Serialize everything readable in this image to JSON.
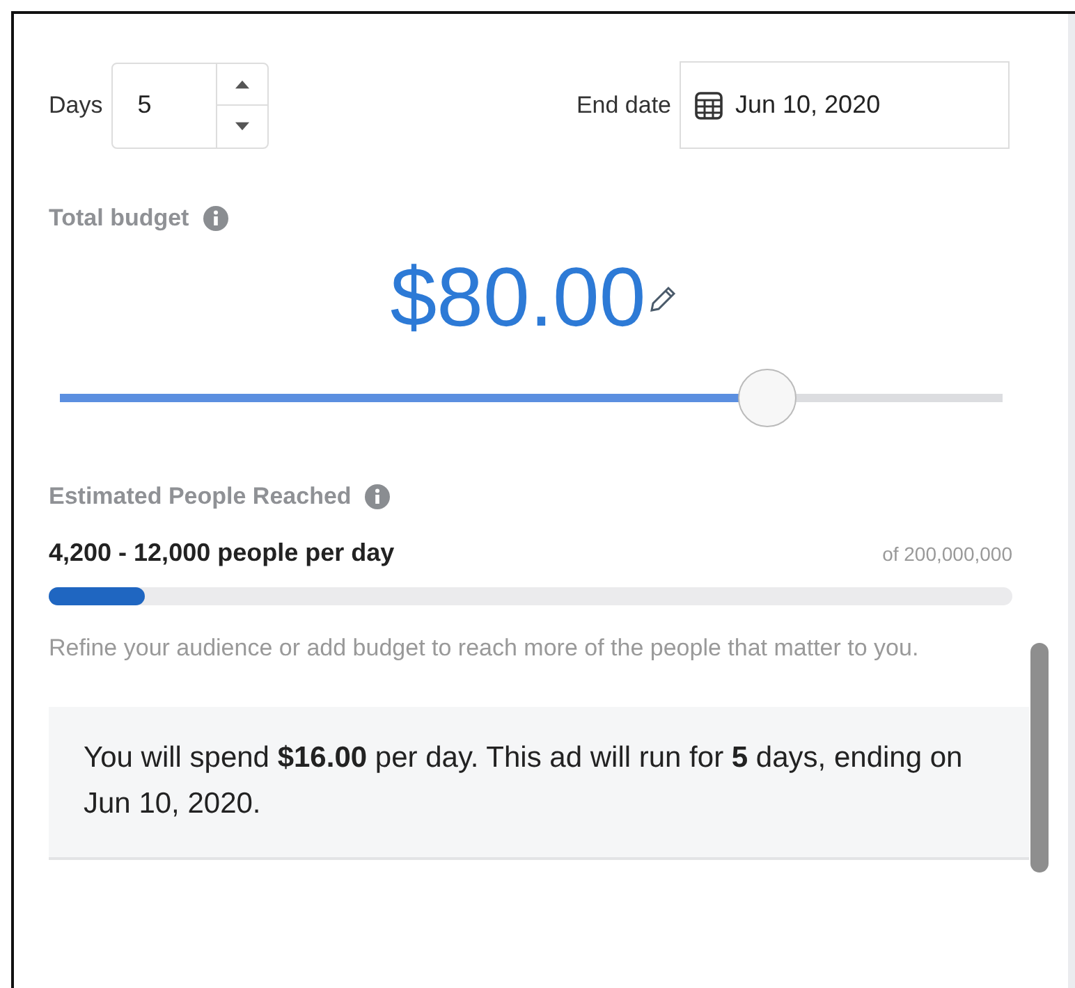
{
  "duration": {
    "days_label": "Days",
    "days_value": "5",
    "end_date_label": "End date",
    "end_date_value": "Jun 10, 2020"
  },
  "budget": {
    "label": "Total budget",
    "amount": "$80.00",
    "level": 0.75
  },
  "reach": {
    "label": "Estimated People Reached",
    "range": "4,200 - 12,000 people per day",
    "total": "of 200,000,000",
    "level": 0.1,
    "hint": "Refine your audience or add budget to reach more of the people that matter to you."
  },
  "summary": "You will spend **$16.00** per day. This ad will run for **5** days, ending on Jun 10, 2020."
}
